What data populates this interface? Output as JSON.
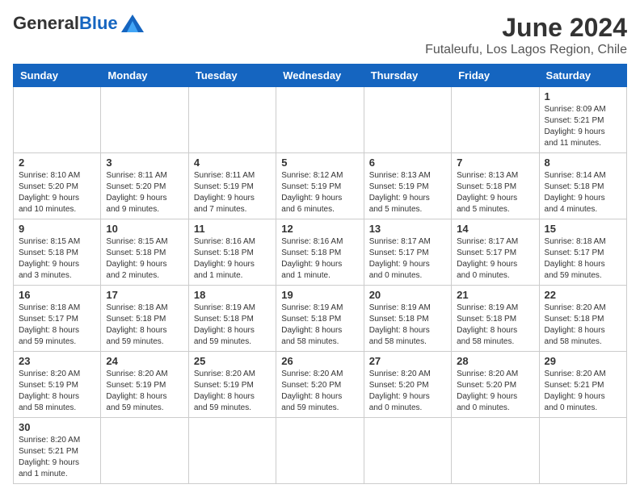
{
  "header": {
    "logo_general": "General",
    "logo_blue": "Blue",
    "month_title": "June 2024",
    "location": "Futaleufu, Los Lagos Region, Chile"
  },
  "weekdays": [
    "Sunday",
    "Monday",
    "Tuesday",
    "Wednesday",
    "Thursday",
    "Friday",
    "Saturday"
  ],
  "weeks": [
    [
      {
        "day": "",
        "info": ""
      },
      {
        "day": "",
        "info": ""
      },
      {
        "day": "",
        "info": ""
      },
      {
        "day": "",
        "info": ""
      },
      {
        "day": "",
        "info": ""
      },
      {
        "day": "",
        "info": ""
      },
      {
        "day": "1",
        "info": "Sunrise: 8:09 AM\nSunset: 5:21 PM\nDaylight: 9 hours\nand 11 minutes."
      }
    ],
    [
      {
        "day": "2",
        "info": "Sunrise: 8:10 AM\nSunset: 5:20 PM\nDaylight: 9 hours\nand 10 minutes."
      },
      {
        "day": "3",
        "info": "Sunrise: 8:11 AM\nSunset: 5:20 PM\nDaylight: 9 hours\nand 9 minutes."
      },
      {
        "day": "4",
        "info": "Sunrise: 8:11 AM\nSunset: 5:19 PM\nDaylight: 9 hours\nand 7 minutes."
      },
      {
        "day": "5",
        "info": "Sunrise: 8:12 AM\nSunset: 5:19 PM\nDaylight: 9 hours\nand 6 minutes."
      },
      {
        "day": "6",
        "info": "Sunrise: 8:13 AM\nSunset: 5:19 PM\nDaylight: 9 hours\nand 5 minutes."
      },
      {
        "day": "7",
        "info": "Sunrise: 8:13 AM\nSunset: 5:18 PM\nDaylight: 9 hours\nand 5 minutes."
      },
      {
        "day": "8",
        "info": "Sunrise: 8:14 AM\nSunset: 5:18 PM\nDaylight: 9 hours\nand 4 minutes."
      }
    ],
    [
      {
        "day": "9",
        "info": "Sunrise: 8:15 AM\nSunset: 5:18 PM\nDaylight: 9 hours\nand 3 minutes."
      },
      {
        "day": "10",
        "info": "Sunrise: 8:15 AM\nSunset: 5:18 PM\nDaylight: 9 hours\nand 2 minutes."
      },
      {
        "day": "11",
        "info": "Sunrise: 8:16 AM\nSunset: 5:18 PM\nDaylight: 9 hours\nand 1 minute."
      },
      {
        "day": "12",
        "info": "Sunrise: 8:16 AM\nSunset: 5:18 PM\nDaylight: 9 hours\nand 1 minute."
      },
      {
        "day": "13",
        "info": "Sunrise: 8:17 AM\nSunset: 5:17 PM\nDaylight: 9 hours\nand 0 minutes."
      },
      {
        "day": "14",
        "info": "Sunrise: 8:17 AM\nSunset: 5:17 PM\nDaylight: 9 hours\nand 0 minutes."
      },
      {
        "day": "15",
        "info": "Sunrise: 8:18 AM\nSunset: 5:17 PM\nDaylight: 8 hours\nand 59 minutes."
      }
    ],
    [
      {
        "day": "16",
        "info": "Sunrise: 8:18 AM\nSunset: 5:17 PM\nDaylight: 8 hours\nand 59 minutes."
      },
      {
        "day": "17",
        "info": "Sunrise: 8:18 AM\nSunset: 5:18 PM\nDaylight: 8 hours\nand 59 minutes."
      },
      {
        "day": "18",
        "info": "Sunrise: 8:19 AM\nSunset: 5:18 PM\nDaylight: 8 hours\nand 59 minutes."
      },
      {
        "day": "19",
        "info": "Sunrise: 8:19 AM\nSunset: 5:18 PM\nDaylight: 8 hours\nand 58 minutes."
      },
      {
        "day": "20",
        "info": "Sunrise: 8:19 AM\nSunset: 5:18 PM\nDaylight: 8 hours\nand 58 minutes."
      },
      {
        "day": "21",
        "info": "Sunrise: 8:19 AM\nSunset: 5:18 PM\nDaylight: 8 hours\nand 58 minutes."
      },
      {
        "day": "22",
        "info": "Sunrise: 8:20 AM\nSunset: 5:18 PM\nDaylight: 8 hours\nand 58 minutes."
      }
    ],
    [
      {
        "day": "23",
        "info": "Sunrise: 8:20 AM\nSunset: 5:19 PM\nDaylight: 8 hours\nand 58 minutes."
      },
      {
        "day": "24",
        "info": "Sunrise: 8:20 AM\nSunset: 5:19 PM\nDaylight: 8 hours\nand 59 minutes."
      },
      {
        "day": "25",
        "info": "Sunrise: 8:20 AM\nSunset: 5:19 PM\nDaylight: 8 hours\nand 59 minutes."
      },
      {
        "day": "26",
        "info": "Sunrise: 8:20 AM\nSunset: 5:20 PM\nDaylight: 8 hours\nand 59 minutes."
      },
      {
        "day": "27",
        "info": "Sunrise: 8:20 AM\nSunset: 5:20 PM\nDaylight: 9 hours\nand 0 minutes."
      },
      {
        "day": "28",
        "info": "Sunrise: 8:20 AM\nSunset: 5:20 PM\nDaylight: 9 hours\nand 0 minutes."
      },
      {
        "day": "29",
        "info": "Sunrise: 8:20 AM\nSunset: 5:21 PM\nDaylight: 9 hours\nand 0 minutes."
      }
    ],
    [
      {
        "day": "30",
        "info": "Sunrise: 8:20 AM\nSunset: 5:21 PM\nDaylight: 9 hours\nand 1 minute."
      },
      {
        "day": "",
        "info": ""
      },
      {
        "day": "",
        "info": ""
      },
      {
        "day": "",
        "info": ""
      },
      {
        "day": "",
        "info": ""
      },
      {
        "day": "",
        "info": ""
      },
      {
        "day": "",
        "info": ""
      }
    ]
  ]
}
